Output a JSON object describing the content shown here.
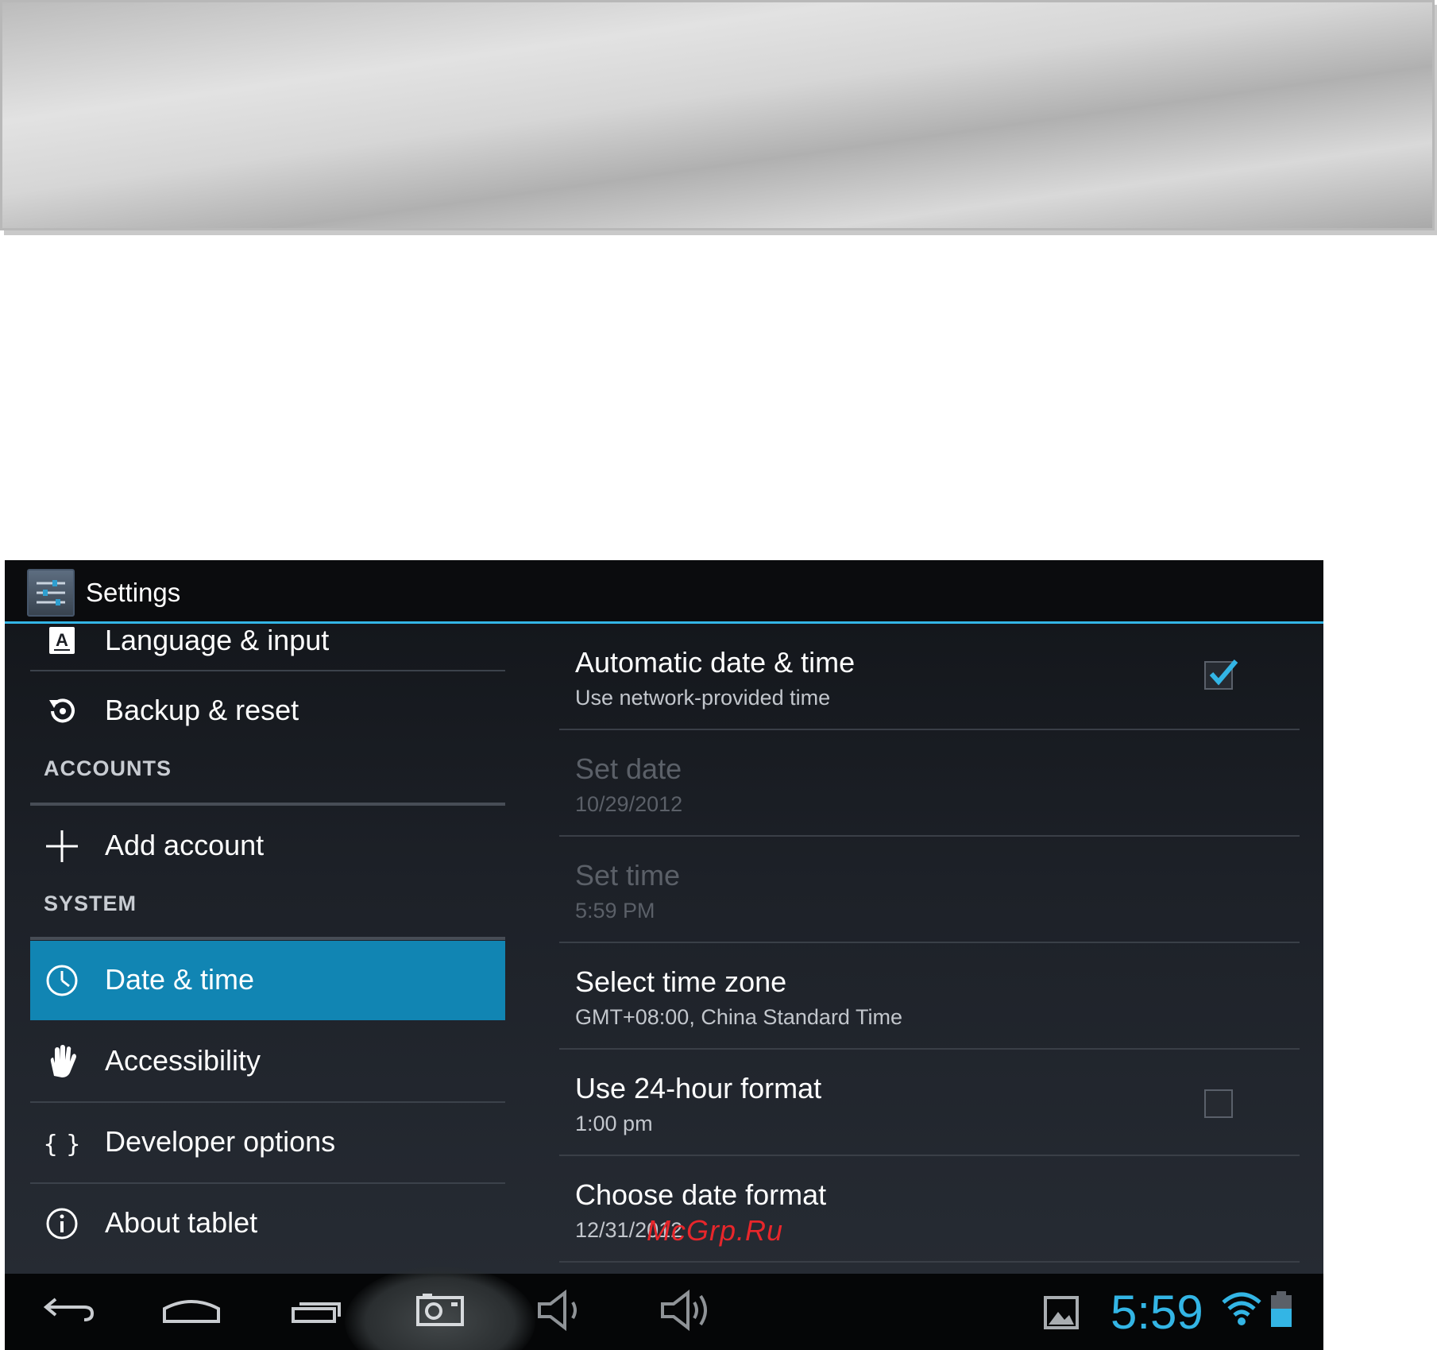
{
  "app": {
    "title": "Settings"
  },
  "left_pane": {
    "items": [
      {
        "label": "Language & input",
        "icon": "language-icon"
      },
      {
        "label": "Backup & reset",
        "icon": "backup-reset-icon"
      }
    ],
    "accounts_header": "ACCOUNTS",
    "accounts_items": [
      {
        "label": "Add account",
        "icon": "plus-icon"
      }
    ],
    "system_header": "SYSTEM",
    "system_items": [
      {
        "label": "Date & time",
        "icon": "clock-icon",
        "selected": true
      },
      {
        "label": "Accessibility",
        "icon": "hand-icon"
      },
      {
        "label": "Developer options",
        "icon": "braces-icon"
      },
      {
        "label": "About tablet",
        "icon": "info-icon"
      }
    ]
  },
  "date_time": {
    "items": [
      {
        "title": "Automatic date & time",
        "summary": "Use network-provided time",
        "checkbox": true,
        "checked": true,
        "enabled": true
      },
      {
        "title": "Set date",
        "summary": "10/29/2012",
        "enabled": false
      },
      {
        "title": "Set time",
        "summary": "5:59 PM",
        "enabled": false
      },
      {
        "title": "Select time zone",
        "summary": "GMT+08:00, China Standard Time",
        "enabled": true
      },
      {
        "title": "Use 24-hour format",
        "summary": "1:00 pm",
        "checkbox": true,
        "checked": false,
        "enabled": true
      },
      {
        "title": "Choose date format",
        "summary": "12/31/2012",
        "enabled": true
      }
    ]
  },
  "watermark": "McGrp.Ru",
  "status_bar": {
    "clock": "5:59",
    "icons": [
      "back-icon",
      "home-icon",
      "recent-apps-icon",
      "screenshot-icon",
      "volume-down-icon",
      "volume-up-icon",
      "gallery-icon",
      "wifi-icon",
      "battery-icon"
    ]
  },
  "colors": {
    "accent": "#33b5e5",
    "selected_bg": "#1185b3",
    "screen_bg": "#1b1e24",
    "watermark": "#e8262b"
  }
}
